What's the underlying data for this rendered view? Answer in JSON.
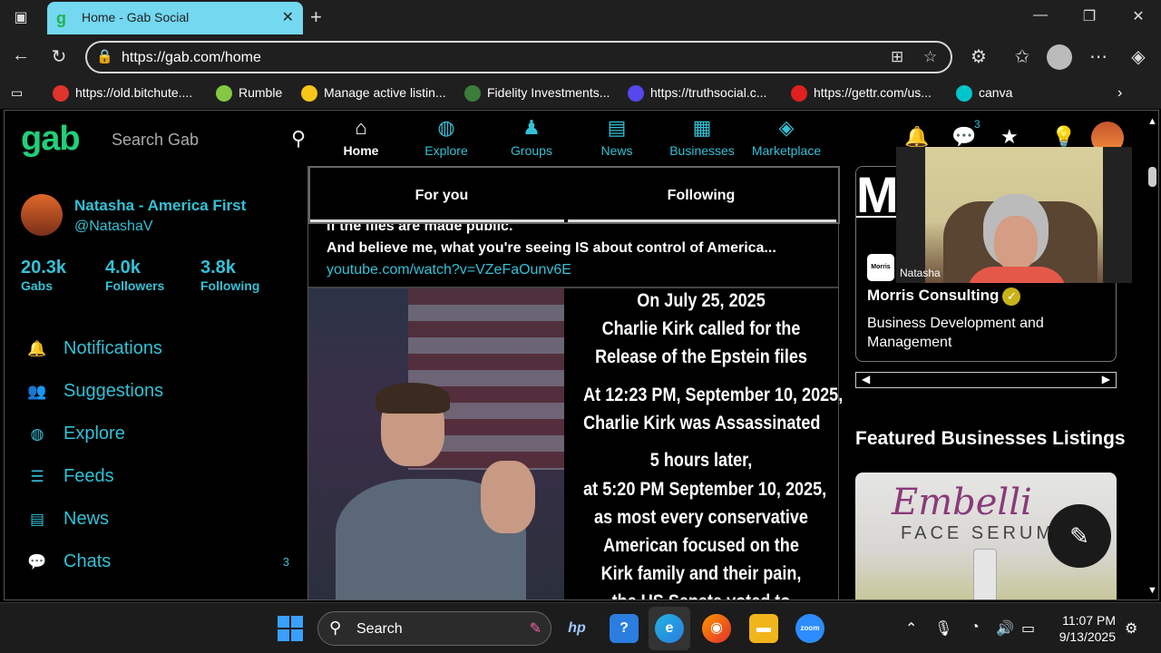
{
  "browser": {
    "tab_title": "Home - Gab Social",
    "url": "https://gab.com/home",
    "bookmarks": [
      {
        "label": "https://old.bitchute....",
        "color": "#e0332c"
      },
      {
        "label": "Rumble",
        "color": "#85c742"
      },
      {
        "label": "Manage active listin...",
        "color": "#f5c518"
      },
      {
        "label": "Fidelity Investments...",
        "color": "#3b7d3b"
      },
      {
        "label": "https://truthsocial.c...",
        "color": "#5448ee"
      },
      {
        "label": "https://gettr.com/us...",
        "color": "#e02020"
      },
      {
        "label": "canva",
        "color": "#00c4cc"
      }
    ]
  },
  "gab": {
    "logo": "gab",
    "search_placeholder": "Search Gab",
    "nav": [
      {
        "label": "Home",
        "icon": "home-icon",
        "glyph": "⌂"
      },
      {
        "label": "Explore",
        "icon": "globe-icon",
        "glyph": "◍"
      },
      {
        "label": "Groups",
        "icon": "groups-icon",
        "glyph": "♟"
      },
      {
        "label": "News",
        "icon": "news-icon",
        "glyph": "▤"
      },
      {
        "label": "Businesses",
        "icon": "grid-icon",
        "glyph": "▦"
      },
      {
        "label": "Marketplace",
        "icon": "tag-icon",
        "glyph": "◈"
      }
    ],
    "chat_badge": "3",
    "profile": {
      "name": "Natasha - America First",
      "handle": "@NatashaV",
      "stats": [
        {
          "value": "20.3k",
          "label": "Gabs"
        },
        {
          "value": "4.0k",
          "label": "Followers"
        },
        {
          "value": "3.8k",
          "label": "Following"
        }
      ]
    },
    "sidebar": [
      {
        "label": "Notifications",
        "icon": "bell-icon",
        "glyph": "🔔",
        "count": ""
      },
      {
        "label": "Suggestions",
        "icon": "users-icon",
        "glyph": "👥",
        "count": ""
      },
      {
        "label": "Explore",
        "icon": "globe-icon",
        "glyph": "◍",
        "count": ""
      },
      {
        "label": "Feeds",
        "icon": "list-icon",
        "glyph": "☰",
        "count": ""
      },
      {
        "label": "News",
        "icon": "news-icon",
        "glyph": "▤",
        "count": ""
      },
      {
        "label": "Chats",
        "icon": "chat-icon",
        "glyph": "💬",
        "count": "3"
      }
    ],
    "feed": {
      "tabs": [
        "For you",
        "Following"
      ],
      "post_line1": "If the files are made public.",
      "post_line2": "And believe me, what you're seeing IS about control of America...",
      "post_link": "youtube.com/watch?v=VZeFaOunv6E",
      "image_text": [
        "On July 25, 2025",
        "Charlie Kirk called for the",
        "Release of the Epstein files",
        "At 12:23 PM, September 10, 2025,",
        "Charlie Kirk was Assassinated",
        "5 hours later,",
        "at 5:20 PM September 10, 2025,",
        "as most every conservative",
        "American focused on the",
        "Kirk family and their pain,",
        "the US Senate voted to"
      ]
    },
    "right": {
      "business_logo_text": "Morris",
      "business_name": "Morris Consulting",
      "business_desc": "Business Development and Management",
      "featured_heading": "Featured Businesses Listings",
      "featured_script": "Embelli",
      "featured_sub": "FACE SERUM"
    },
    "webcam_name": "Natasha"
  },
  "taskbar": {
    "search_label": "Search",
    "time": "11:07 PM",
    "date": "9/13/2025"
  }
}
